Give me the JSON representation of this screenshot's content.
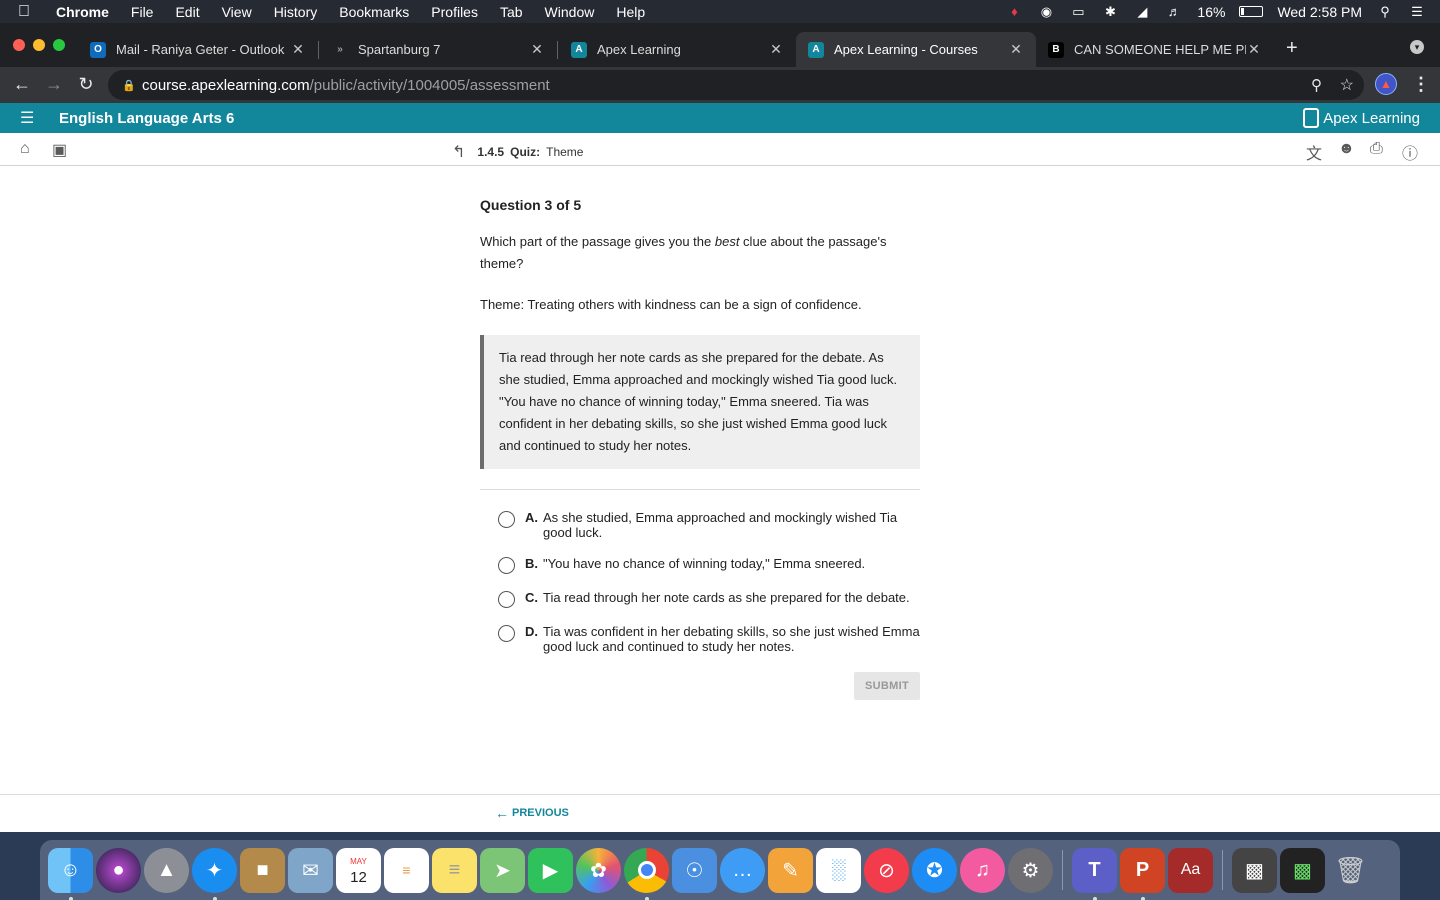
{
  "menubar": {
    "app": "Chrome",
    "items": [
      "File",
      "Edit",
      "View",
      "History",
      "Bookmarks",
      "Profiles",
      "Tab",
      "Window",
      "Help"
    ],
    "battery": "16%",
    "battery_level": 0.16,
    "clock": "Wed 2:58 PM"
  },
  "tabs": [
    {
      "title": "Mail - Raniya Geter - Outlook",
      "favicon": "outlook-icon",
      "color": "#0f6cbd"
    },
    {
      "title": "Spartanburg 7",
      "favicon": "spartanburg-icon",
      "color": "#202124"
    },
    {
      "title": "Apex Learning",
      "favicon": "apex-icon",
      "color": "#12869a"
    },
    {
      "title": "Apex Learning - Courses",
      "favicon": "apex-icon",
      "color": "#12869a"
    },
    {
      "title": "CAN SOMEONE HELP ME PLEA",
      "favicon": "brainly-icon",
      "color": "#000000"
    }
  ],
  "address": {
    "host": "course.apexlearning.com",
    "path": "/public/activity/1004005/assessment"
  },
  "course": {
    "title": "English Language Arts 6",
    "brand": "Apex Learning",
    "breadcrumb_num": "1.4.5",
    "breadcrumb_type": "Quiz:",
    "breadcrumb_title": "Theme"
  },
  "quiz": {
    "count": "Question 3 of 5",
    "prompt_before": "Which part of the passage gives you the ",
    "prompt_em": "best",
    "prompt_after": " clue about the passage's theme?",
    "theme": "Theme: Treating others with kindness can be a sign of confidence.",
    "passage": "Tia read through her note cards as she prepared for the debate. As she studied, Emma approached and mockingly wished Tia good luck. \"You have no chance of winning today,\" Emma sneered. Tia was confident in her debating skills, so she just wished Emma good luck and continued to study her notes.",
    "choices": [
      {
        "letter": "A.",
        "text": "As she studied, Emma approached and mockingly wished Tia good luck."
      },
      {
        "letter": "B.",
        "text": "\"You have no chance of winning today,\" Emma sneered."
      },
      {
        "letter": "C.",
        "text": "Tia read through her note cards as she prepared for the debate."
      },
      {
        "letter": "D.",
        "text": "Tia was confident in her debating skills, so she just wished Emma good luck and continued to study her notes."
      }
    ],
    "submit": "SUBMIT",
    "previous": "PREVIOUS"
  },
  "dock": {
    "calendar_month": "MAY",
    "calendar_day": "12",
    "teams_letter": "T",
    "powerpoint_letter": "P",
    "dictionary_label": "Aa"
  },
  "colors": {
    "accent": "#12869a",
    "tab_active": "#35363a",
    "tab_bg": "#202124"
  }
}
